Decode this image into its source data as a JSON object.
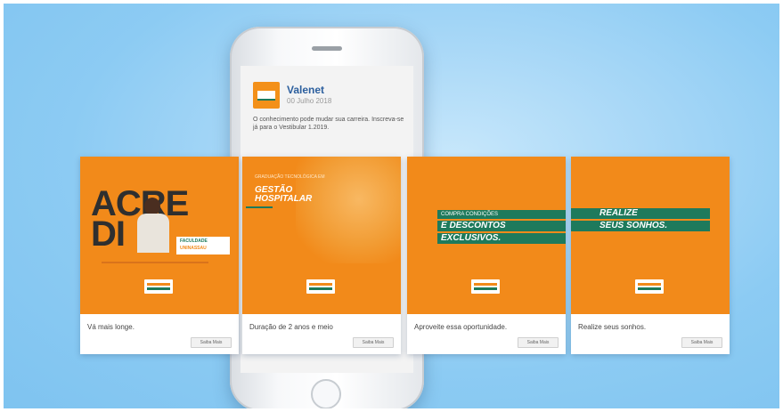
{
  "post": {
    "page_name": "Valenet",
    "date": "00 Julho 2018",
    "text": "O conhecimento pode mudar sua carreira. Inscreva-se já para o Vestibular 1.2019."
  },
  "carousel": {
    "cards": [
      {
        "headline_line1": "ACRE",
        "headline_line2": "DI",
        "badge_line1": "FACULDADE",
        "badge_line2": "UNINASSAU",
        "caption": "Vá mais longe.",
        "button": "Saiba Mais"
      },
      {
        "kicker": "GRADUAÇÃO TECNOLÓGICA EM",
        "title_line1": "GESTÃO",
        "title_line2": "HOSPITALAR",
        "caption": "Duração de 2 anos e meio",
        "button": "Saiba Mais"
      },
      {
        "ribbon_line1": "COMPRA CONDIÇÕES",
        "ribbon_line2": "E DESCONTOS",
        "ribbon_line3": "EXCLUSIVOS.",
        "caption": "Aproveite essa oportunidade.",
        "button": "Saiba Mais"
      },
      {
        "ribbon_line1": "REALIZE",
        "ribbon_line2": "SEUS SONHOS.",
        "caption": "Realize seus sonhos.",
        "button": "Saiba Mais"
      }
    ]
  },
  "colors": {
    "brand_orange": "#f28a1a",
    "brand_green": "#1e7a5c",
    "page_name_blue": "#2c5f9e",
    "background_blue": "#8ccbf3"
  }
}
